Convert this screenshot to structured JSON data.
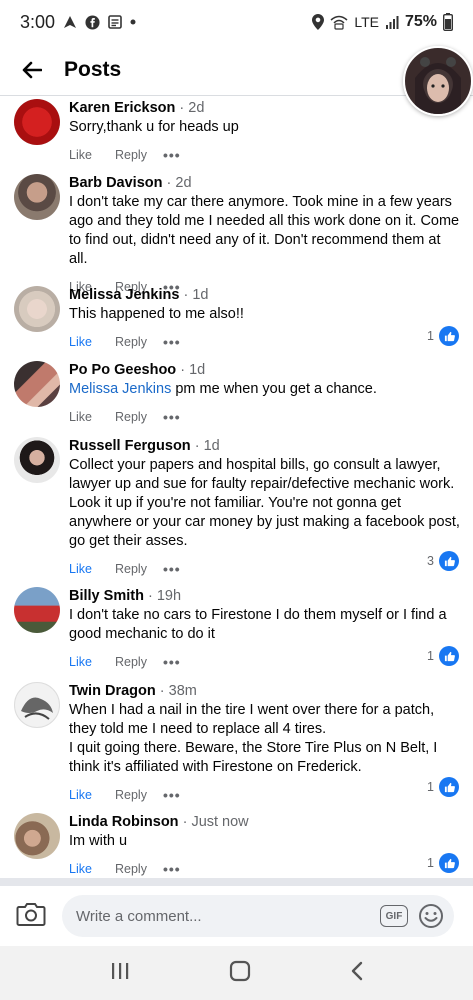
{
  "status_bar": {
    "time": "3:00",
    "network": "LTE",
    "battery": "75%"
  },
  "header": {
    "title": "Posts"
  },
  "comments": [
    {
      "name": "Karen Erickson",
      "time": "2d",
      "text": "Sorry,thank u for heads up",
      "like": "Like",
      "reply": "Reply"
    },
    {
      "name": "Barb Davison",
      "time": "2d",
      "text": "I don't take my car there anymore.  Took mine in a few years ago and they told me I needed all this work done on it.  Come to find out, didn't need any of it.  Don't recommend them at all.",
      "like": "Like",
      "reply": "Reply"
    },
    {
      "name": "Melissa Jenkins",
      "time": "1d",
      "text": "This happened to me also!!",
      "like": "Like",
      "reply": "Reply",
      "reactions": "1"
    },
    {
      "name": "Po Po Geeshoo",
      "time": "1d",
      "mention": "Melissa Jenkins",
      "text": " pm me when you get a chance.",
      "like": "Like",
      "reply": "Reply"
    },
    {
      "name": "Russell Ferguson",
      "time": "1d",
      "text": "Collect your papers and hospital bills, go consult a lawyer, lawyer up and sue for faulty repair/defective mechanic work. Look it up if you're not familiar. You're not gonna get anywhere or your car money by just making a facebook post, go get their asses.",
      "like": "Like",
      "reply": "Reply",
      "reactions": "3"
    },
    {
      "name": "Billy Smith",
      "time": "19h",
      "text": "I don't take no cars to Firestone I do them myself or I find a good mechanic to do it",
      "like": "Like",
      "reply": "Reply",
      "reactions": "1"
    },
    {
      "name": "Twin Dragon",
      "time": "38m",
      "text": "When I had a nail in the tire I went over there for a patch, they told me I need to replace all 4 tires.",
      "text2": "I quit going there. Beware, the Store Tire Plus on N Belt, I think it's affiliated with Firestone on Frederick.",
      "like": "Like",
      "reply": "Reply",
      "reactions": "1"
    },
    {
      "name": "Linda Robinson",
      "time": "Just now",
      "text": "Im with u",
      "like": "Like",
      "reply": "Reply",
      "reactions": "1"
    }
  ],
  "composer": {
    "placeholder": "Write a comment...",
    "gif_label": "GIF"
  },
  "colors": {
    "accent": "#1877f2",
    "mention": "#1b6ac9",
    "muted": "#65676b"
  }
}
